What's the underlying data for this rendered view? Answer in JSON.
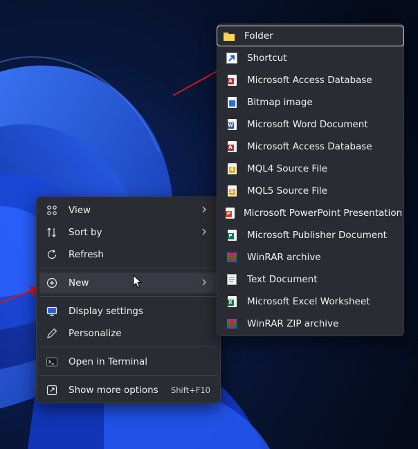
{
  "context_menu": {
    "items": [
      {
        "label": "View",
        "icon": "grid-icon"
      },
      {
        "label": "Sort by",
        "icon": "sort-icon"
      },
      {
        "label": "Refresh",
        "icon": "refresh-icon"
      },
      {
        "label": "New",
        "icon": "plus-circle-icon"
      },
      {
        "label": "Display settings",
        "icon": "display-icon"
      },
      {
        "label": "Personalize",
        "icon": "pen-icon"
      },
      {
        "label": "Open in Terminal",
        "icon": "terminal-icon"
      },
      {
        "label": "Show more options",
        "icon": "expand-icon",
        "shortcut": "Shift+F10"
      }
    ]
  },
  "new_submenu": {
    "items": [
      {
        "label": "Folder",
        "icon": "folder-icon"
      },
      {
        "label": "Shortcut",
        "icon": "shortcut-icon"
      },
      {
        "label": "Microsoft Access Database",
        "icon": "access-icon"
      },
      {
        "label": "Bitmap image",
        "icon": "bitmap-icon"
      },
      {
        "label": "Microsoft Word Document",
        "icon": "word-icon"
      },
      {
        "label": "Microsoft Access Database",
        "icon": "access-icon"
      },
      {
        "label": "MQL4 Source File",
        "icon": "mql4-icon"
      },
      {
        "label": "MQL5 Source File",
        "icon": "mql5-icon"
      },
      {
        "label": "Microsoft PowerPoint Presentation",
        "icon": "powerpoint-icon"
      },
      {
        "label": "Microsoft Publisher Document",
        "icon": "publisher-icon"
      },
      {
        "label": "WinRAR archive",
        "icon": "winrar-icon"
      },
      {
        "label": "Text Document",
        "icon": "text-icon"
      },
      {
        "label": "Microsoft Excel Worksheet",
        "icon": "excel-icon"
      },
      {
        "label": "WinRAR ZIP archive",
        "icon": "winrar-zip-icon"
      }
    ]
  },
  "colors": {
    "menu_bg": "#2a2c33",
    "annotation_arrow": "#d8141a",
    "wallpaper_bloom": "#1f4fe0"
  }
}
